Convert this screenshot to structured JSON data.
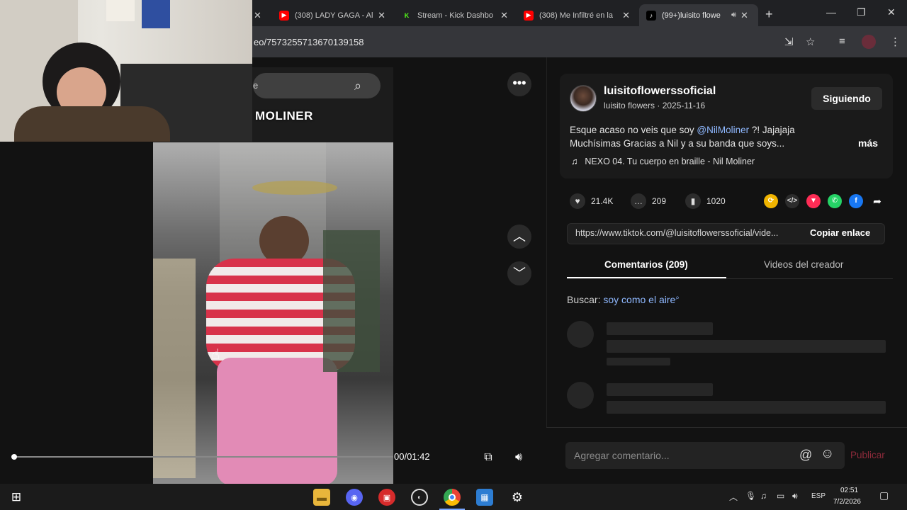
{
  "browser": {
    "tabs": [
      {
        "label": "(308) LADY GAGA - Al",
        "icon": "youtube-icon"
      },
      {
        "label": "Stream - Kick Dashbo",
        "icon": "kick-icon"
      },
      {
        "label": "(308) Me Infiltré en la",
        "icon": "youtube-icon"
      },
      {
        "label": "(99+)luisito flowe",
        "icon": "tiktok-icon",
        "active": true
      }
    ],
    "new_tab_label": "+",
    "url": "eo/7573255713670139158"
  },
  "video": {
    "overlay_text": "MOLINER",
    "search_partial": "e",
    "time": "00/01:42"
  },
  "post": {
    "username": "luisitoflowerssoficial",
    "subline": "luisito flowers · 2025-11-16",
    "follow_label": "Siguiendo",
    "description_pre": "Esque acaso no veis que soy ",
    "mention": "@NilMoliner",
    "description_post": " ?! Jajajaja Muchísimas Gracias a Nil y a su banda que soys...",
    "more_label": "más",
    "music": "NEXO 04. Tu cuerpo en braille - Nil Moliner",
    "likes": "21.4K",
    "comments": "209",
    "saves": "1020",
    "link_url": "https://www.tiktok.com/@luisitoflowerssoficial/vide...",
    "copy_label": "Copiar enlace",
    "tab_comments": "Comentarios (209)",
    "tab_creator": "Videos del creador",
    "search_label": "Buscar:",
    "search_query": "soy como el aire",
    "comment_placeholder": "Agregar comentario...",
    "publish_label": "Publicar"
  },
  "taskbar": {
    "lang": "ESP",
    "time": "02:51",
    "date": "7/2/2026"
  },
  "colors": {
    "accent_link": "#8fb8ff",
    "publish_disabled": "#8c2a3a",
    "youtube_red": "#ff0000",
    "kick_green": "#53fc18"
  }
}
